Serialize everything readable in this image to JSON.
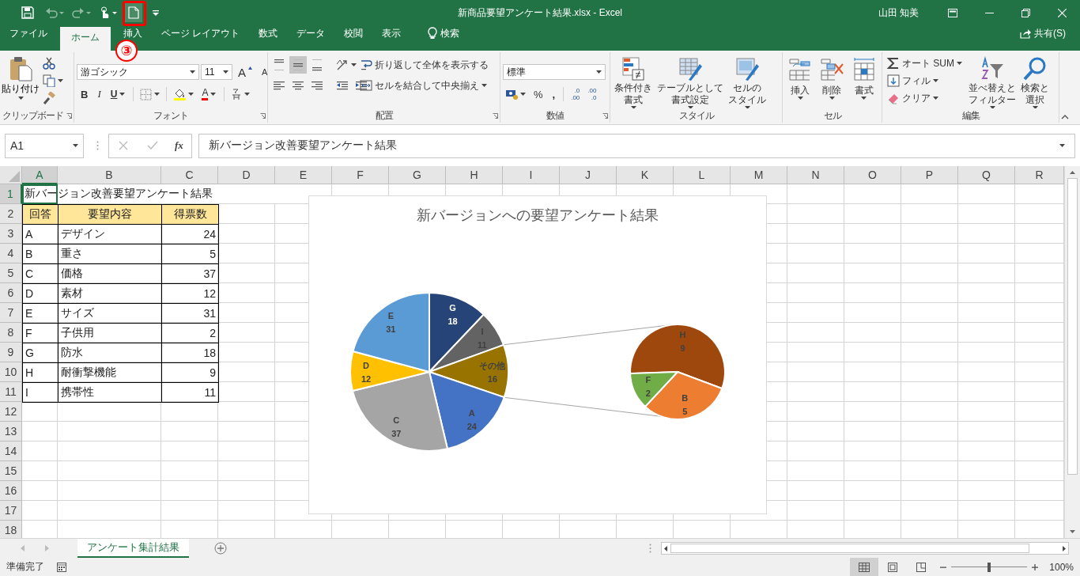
{
  "title_bar": {
    "title": "新商品要望アンケート結果.xlsx - Excel",
    "user": "山田 知美",
    "callout": "③"
  },
  "ribbon_tabs": [
    {
      "label": "ファイル",
      "selected": false
    },
    {
      "label": "ホーム",
      "selected": true
    },
    {
      "label": "挿入",
      "selected": false
    },
    {
      "label": "ページ レイアウト",
      "selected": false
    },
    {
      "label": "数式",
      "selected": false
    },
    {
      "label": "データ",
      "selected": false
    },
    {
      "label": "校閲",
      "selected": false
    },
    {
      "label": "表示",
      "selected": false
    }
  ],
  "tell_me": "検索",
  "share": "共有(S)",
  "ribbon_groups": [
    {
      "kind": "clipboard",
      "label": "クリップボード",
      "paste": "貼り付け"
    },
    {
      "kind": "font",
      "label": "フォント",
      "font_name": "游ゴシック",
      "font_size": "11",
      "grow": "A",
      "shrink": "A",
      "bold": "B",
      "italic": "I",
      "underline": "U",
      "font_color": "A"
    },
    {
      "kind": "alignment",
      "label": "配置",
      "wrap_text": "折り返して全体を表示する",
      "merge_center": "セルを結合して中央揃え"
    },
    {
      "kind": "number",
      "label": "数値",
      "format": "標準",
      "percent": "%",
      "comma": ",",
      "decimals": [
        [
          ".0",
          ".00"
        ],
        [
          ".00",
          ".0"
        ]
      ]
    },
    {
      "kind": "styles",
      "label": "スタイル",
      "buttons": [
        [
          "条件付き",
          "書式"
        ],
        [
          "テーブルとして",
          "書式設定"
        ],
        [
          "セルの",
          "スタイル"
        ]
      ]
    },
    {
      "kind": "cells",
      "label": "セル",
      "buttons": [
        "挿入",
        "削除",
        "書式"
      ]
    },
    {
      "kind": "editing",
      "label": "編集",
      "autosum": "オート SUM",
      "fill": "フィル",
      "clear": "クリア",
      "sort_filter": [
        "並べ替えと",
        "フィルター"
      ],
      "find_select": [
        "検索と",
        "選択"
      ]
    }
  ],
  "formula_bar": {
    "name_box": "A1",
    "fx": "fx",
    "value": "新バージョン改善要望アンケート結果"
  },
  "sheet": {
    "columns": [
      {
        "label": "A",
        "selected": true
      },
      {
        "label": "B",
        "selected": false
      },
      {
        "label": "C",
        "selected": false
      },
      {
        "label": "D",
        "selected": false
      },
      {
        "label": "E",
        "selected": false
      },
      {
        "label": "F",
        "selected": false
      },
      {
        "label": "G",
        "selected": false
      },
      {
        "label": "H",
        "selected": false
      },
      {
        "label": "I",
        "selected": false
      },
      {
        "label": "J",
        "selected": false
      },
      {
        "label": "K",
        "selected": false
      },
      {
        "label": "L",
        "selected": false
      },
      {
        "label": "M",
        "selected": false
      },
      {
        "label": "N",
        "selected": false
      },
      {
        "label": "O",
        "selected": false
      },
      {
        "label": "P",
        "selected": false
      },
      {
        "label": "Q",
        "selected": false
      },
      {
        "label": "R",
        "selected": false
      }
    ],
    "rows": [
      {
        "label": "1",
        "selected": true,
        "kind": "title",
        "cells": [
          "新バージョン改善要望アンケート結果"
        ]
      },
      {
        "label": "2",
        "selected": false,
        "kind": "header",
        "cells": [
          "回答",
          "要望内容",
          "得票数"
        ]
      },
      {
        "label": "3",
        "selected": false,
        "kind": "data",
        "cells": [
          "A",
          "デザイン",
          "24"
        ]
      },
      {
        "label": "4",
        "selected": false,
        "kind": "data",
        "cells": [
          "B",
          "重さ",
          "5"
        ]
      },
      {
        "label": "5",
        "selected": false,
        "kind": "data",
        "cells": [
          "C",
          "価格",
          "37"
        ]
      },
      {
        "label": "6",
        "selected": false,
        "kind": "data",
        "cells": [
          "D",
          "素材",
          "12"
        ]
      },
      {
        "label": "7",
        "selected": false,
        "kind": "data",
        "cells": [
          "E",
          "サイズ",
          "31"
        ]
      },
      {
        "label": "8",
        "selected": false,
        "kind": "data",
        "cells": [
          "F",
          "子供用",
          "2"
        ]
      },
      {
        "label": "9",
        "selected": false,
        "kind": "data",
        "cells": [
          "G",
          "防水",
          "18"
        ]
      },
      {
        "label": "10",
        "selected": false,
        "kind": "data",
        "cells": [
          "H",
          "耐衝撃機能",
          "9"
        ]
      },
      {
        "label": "11",
        "selected": false,
        "kind": "data",
        "cells": [
          "I",
          "携帯性",
          "11"
        ]
      },
      {
        "label": "12",
        "selected": false
      },
      {
        "label": "13",
        "selected": false
      },
      {
        "label": "14",
        "selected": false
      },
      {
        "label": "15",
        "selected": false
      },
      {
        "label": "16",
        "selected": false
      },
      {
        "label": "17",
        "selected": false
      },
      {
        "label": "18",
        "selected": false
      }
    ]
  },
  "chart": {
    "title": "新バージョンへの要望アンケート結果",
    "main_pie": {
      "chart_data": {
        "type": "pie",
        "categories": [
          "G",
          "I",
          "その他",
          "A",
          "C",
          "D",
          "E"
        ],
        "values": [
          18,
          11,
          16,
          24,
          37,
          12,
          31
        ],
        "colors": [
          "#264478",
          "#636363",
          "#997300",
          "#4472c4",
          "#a5a5a5",
          "#ffc000",
          "#5b9bd5"
        ],
        "data_labels": true
      }
    },
    "secondary_pie": {
      "chart_data": {
        "type": "pie",
        "categories": [
          "H",
          "B",
          "F"
        ],
        "values": [
          9,
          5,
          2
        ],
        "colors": [
          "#9e480e",
          "#ed7d31",
          "#70ad47"
        ],
        "data_labels": true
      }
    }
  },
  "sheet_tabs": [
    {
      "label": "アンケート集計結果",
      "selected": true
    }
  ],
  "status_bar": {
    "status": "準備完了",
    "zoom": "100%",
    "zoom_slider": {
      "level": 0.5
    }
  }
}
